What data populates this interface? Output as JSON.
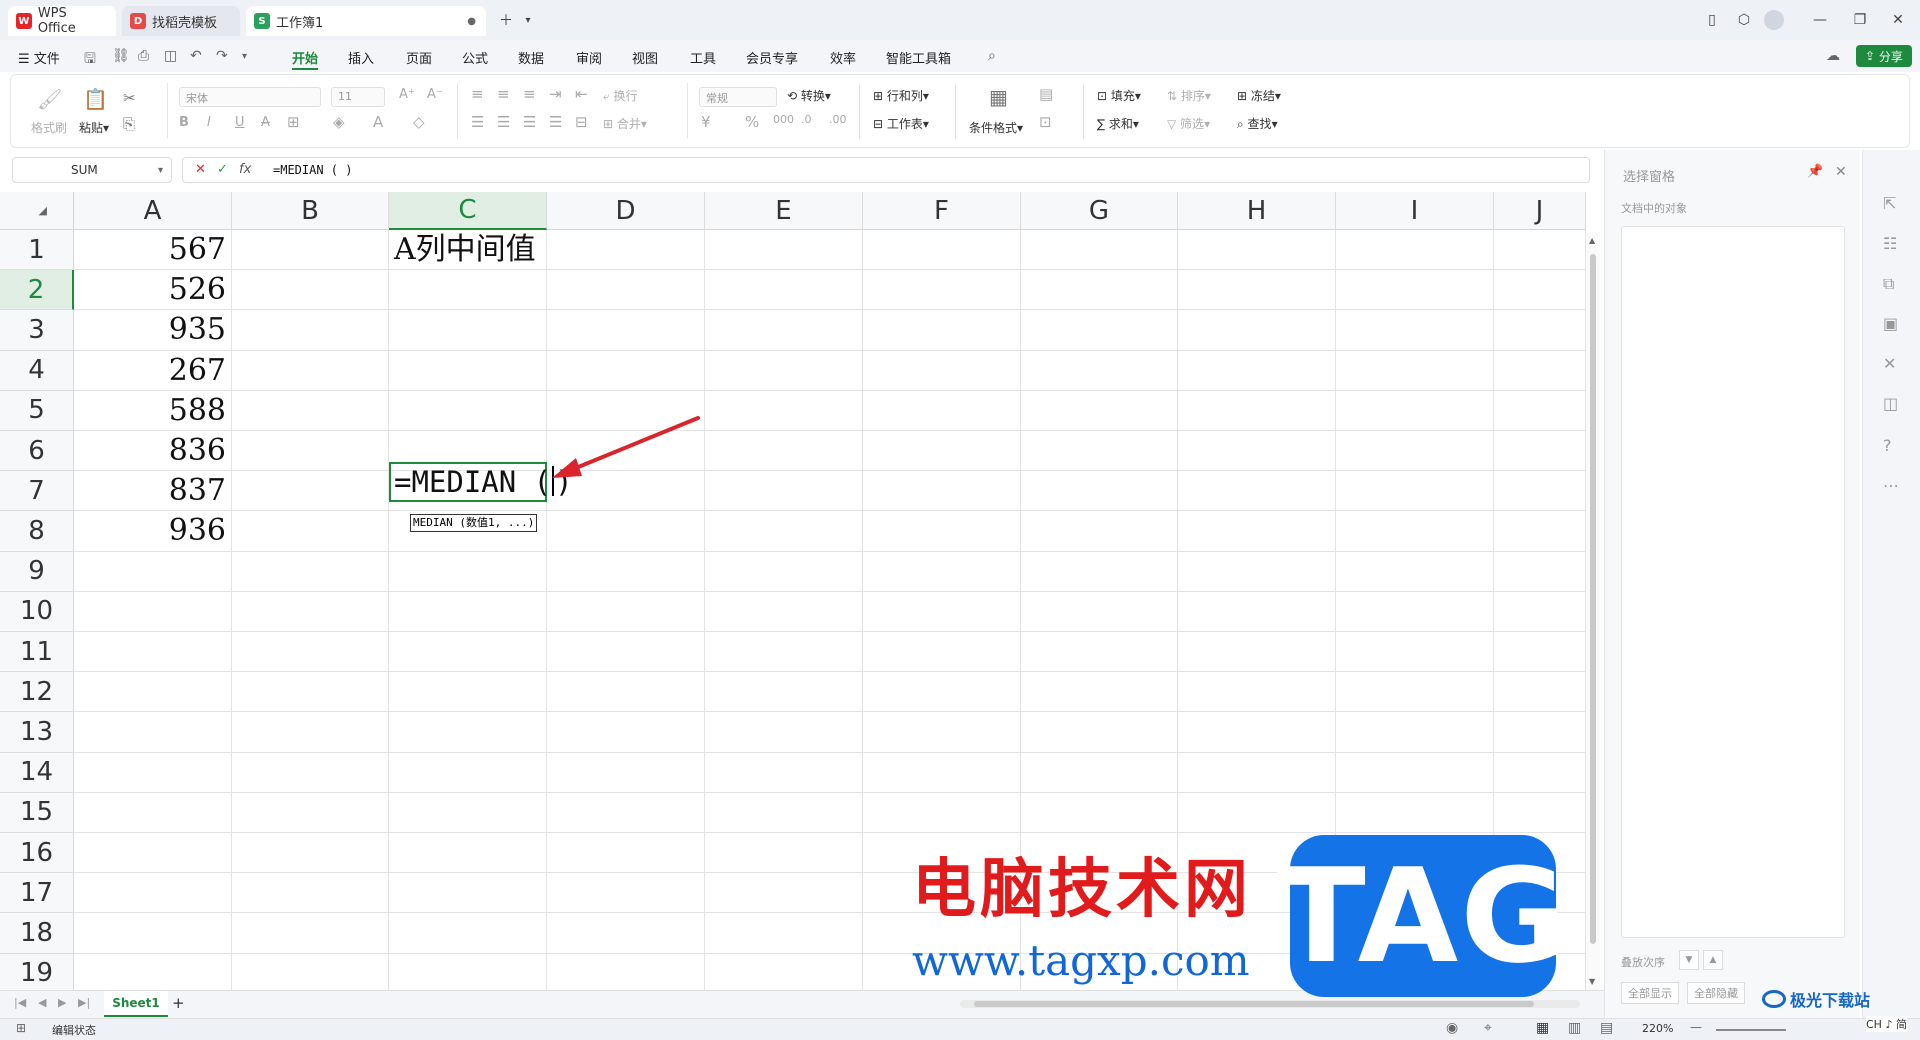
{
  "tabs": [
    {
      "label": "WPS Office",
      "icon": "wps-logo-icon",
      "color": "#e4262b"
    },
    {
      "label": "找稻壳模板",
      "icon": "docer-icon",
      "color": "#e44a4a"
    },
    {
      "label": "工作簿1",
      "icon": "sheet-icon",
      "color": "#2aa05a"
    }
  ],
  "menu": {
    "file": "文件",
    "items": [
      "开始",
      "插入",
      "页面",
      "公式",
      "数据",
      "审阅",
      "视图",
      "工具",
      "会员专享",
      "效率",
      "智能工具箱"
    ],
    "share": "分享"
  },
  "ribbon": {
    "format_painter": "格式刷",
    "paste": "粘贴",
    "font_name": "宋体",
    "font_size": "11",
    "wrap": "换行",
    "merge": "合并",
    "number_format": "常规",
    "convert": "转换",
    "row_col": "行和列",
    "worksheet": "工作表",
    "cond_format": "条件格式",
    "fill": "填充",
    "sort": "排序",
    "freeze": "冻结",
    "sum": "求和",
    "filter": "筛选",
    "find": "查找"
  },
  "formula_bar": {
    "name_box": "SUM",
    "fx": "fx",
    "content": "=MEDIAN ( )"
  },
  "columns": [
    "A",
    "B",
    "C",
    "D",
    "E",
    "F",
    "G",
    "H",
    "I",
    "J"
  ],
  "rows": [
    "1",
    "2",
    "3",
    "4",
    "5",
    "6",
    "7",
    "8",
    "9",
    "10",
    "11",
    "12",
    "13",
    "14",
    "15",
    "16",
    "17",
    "18",
    "19"
  ],
  "cells": {
    "a_values": [
      "567",
      "526",
      "935",
      "267",
      "588",
      "836",
      "837",
      "936"
    ],
    "c1": "A列中间值",
    "c2": "=MEDIAN (",
    "c2_close": ")",
    "tooltip": "MEDIAN (数值1, ...)"
  },
  "right_panel": {
    "title": "选择窗格",
    "subtitle": "文档中的对象",
    "order": "叠放次序",
    "show_all": "全部显示",
    "hide_all": "全部隐藏"
  },
  "sheet_tab": "Sheet1",
  "status": {
    "mode": "编辑状态",
    "zoom": "220%"
  },
  "watermark": {
    "cn": "电脑技术网",
    "url": "www.tagxp.com",
    "tag": "TAG",
    "logo": "极光下载站",
    "logo2": "CH ♪ 简"
  },
  "colors": {
    "accent": "#1e8a3e",
    "arrow": "#d9252b",
    "watermark_blue": "#1473e6",
    "watermark_red": "#e11b1b"
  }
}
